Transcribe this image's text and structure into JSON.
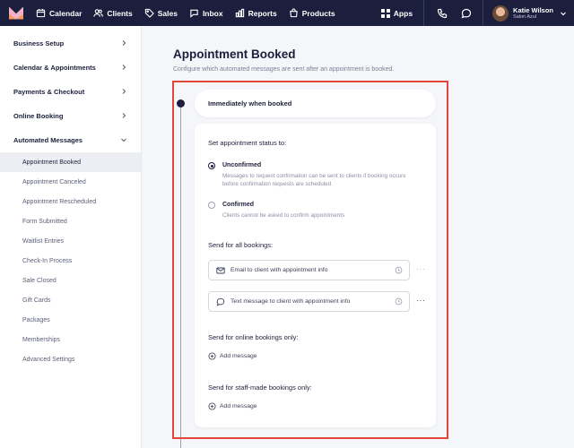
{
  "nav": {
    "items": [
      {
        "label": "Calendar",
        "icon": "calendar-icon"
      },
      {
        "label": "Clients",
        "icon": "users-icon"
      },
      {
        "label": "Sales",
        "icon": "tag-icon"
      },
      {
        "label": "Inbox",
        "icon": "chat-icon"
      },
      {
        "label": "Reports",
        "icon": "bar-chart-icon"
      },
      {
        "label": "Products",
        "icon": "bag-icon"
      }
    ],
    "apps_label": "Apps",
    "user_name": "Katie Wilson",
    "user_business": "Salon Azul"
  },
  "sidebar": {
    "sections": [
      {
        "label": "Business Setup"
      },
      {
        "label": "Calendar & Appointments"
      },
      {
        "label": "Payments & Checkout"
      },
      {
        "label": "Online Booking"
      },
      {
        "label": "Automated Messages"
      }
    ],
    "subitems": [
      {
        "label": "Appointment Booked",
        "active": true
      },
      {
        "label": "Appointment Canceled"
      },
      {
        "label": "Appointment Rescheduled"
      },
      {
        "label": "Form Submitted"
      },
      {
        "label": "Waitlist Entries"
      },
      {
        "label": "Check-In Process"
      },
      {
        "label": "Sale Closed"
      },
      {
        "label": "Gift Cards"
      },
      {
        "label": "Packages"
      },
      {
        "label": "Memberships"
      },
      {
        "label": "Advanced Settings"
      }
    ]
  },
  "main": {
    "title": "Appointment Booked",
    "subtitle": "Configure which automated messages are sent after an appointment is booked.",
    "trigger_label": "Immediately when booked",
    "status_label": "Set appointment status to:",
    "options": [
      {
        "title": "Unconfirmed",
        "desc": "Messages to request confirmation can be sent to clients if booking occurs before confirmation requests are scheduled",
        "selected": true
      },
      {
        "title": "Confirmed",
        "desc": "Clients cannot be asked to confirm appointments",
        "selected": false
      }
    ],
    "all_bookings_label": "Send for all bookings:",
    "messages": [
      {
        "label": "Email to client with appointment info",
        "icon": "mail-icon"
      },
      {
        "label": "Text message to client with appointment info",
        "icon": "sms-icon"
      }
    ],
    "online_label": "Send for online bookings only:",
    "staff_label": "Send for staff-made bookings only:",
    "add_message_label": "Add message",
    "more_label": "···"
  }
}
